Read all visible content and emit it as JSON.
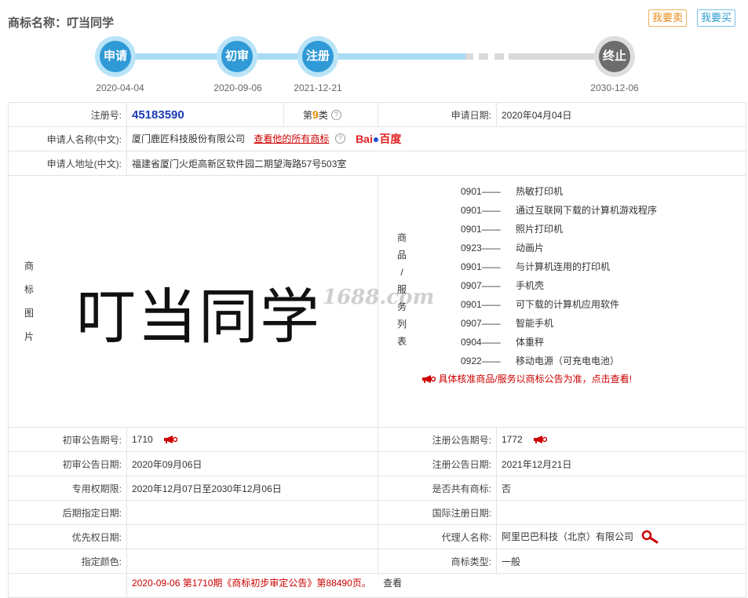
{
  "header": {
    "label": "商标名称：",
    "name": "叮当同学",
    "sell_label": "我要卖",
    "buy_label": "我要买"
  },
  "timeline": [
    {
      "label": "申请",
      "date": "2020-04-04"
    },
    {
      "label": "初审",
      "date": "2020-09-06"
    },
    {
      "label": "注册",
      "date": "2021-12-21"
    },
    {
      "label": "终止",
      "date": "2030-12-06"
    }
  ],
  "info": {
    "reg_no_label": "注册号:",
    "reg_no": "45183590",
    "class_prefix": "第",
    "class_num": "9",
    "class_suffix": "类",
    "apply_date_label": "申请日期:",
    "apply_date": "2020年04月04日",
    "applicant_label": "申请人名称(中文):",
    "applicant": "厦门鹿匠科技股份有限公司",
    "all_marks_link": "查看他的所有商标",
    "baidu_b1": "Bai",
    "baidu_b2": "百度",
    "address_label": "申请人地址(中文):",
    "address": "福建省厦门火炬高新区软件园二期望海路57号503室",
    "image_label": [
      "商",
      "标",
      "图",
      "片"
    ],
    "tm_text": "叮当同学",
    "watermark": "1688.com",
    "goods_label": [
      "商",
      "品",
      "/",
      "服",
      "务",
      "列",
      "表"
    ],
    "goods": [
      {
        "code": "0901——",
        "name": "热敏打印机"
      },
      {
        "code": "0901——",
        "name": "通过互联网下载的计算机游戏程序"
      },
      {
        "code": "0901——",
        "name": "照片打印机"
      },
      {
        "code": "0923——",
        "name": "动画片"
      },
      {
        "code": "0901——",
        "name": "与计算机连用的打印机"
      },
      {
        "code": "0907——",
        "name": "手机壳"
      },
      {
        "code": "0901——",
        "name": "可下载的计算机应用软件"
      },
      {
        "code": "0907——",
        "name": "智能手机"
      },
      {
        "code": "0904——",
        "name": "体重秤"
      },
      {
        "code": "0922——",
        "name": "移动电源（可充电电池）"
      }
    ],
    "goods_notice": "具体核准商品/服务以商标公告为准，点击查看!",
    "prelim_no_label": "初审公告期号:",
    "prelim_no": "1710",
    "reg_pub_no_label": "注册公告期号:",
    "reg_pub_no": "1772",
    "prelim_date_label": "初审公告日期:",
    "prelim_date": "2020年09月06日",
    "reg_pub_date_label": "注册公告日期:",
    "reg_pub_date": "2021年12月21日",
    "exclusive_label": "专用权期限:",
    "exclusive": "2020年12月07日至2030年12月06日",
    "shared_label": "是否共有商标:",
    "shared": "否",
    "later_label": "后期指定日期:",
    "later": "",
    "intl_label": "国际注册日期:",
    "intl": "",
    "priority_label": "优先权日期:",
    "priority": "",
    "agent_label": "代理人名称:",
    "agent": "阿里巴巴科技（北京）有限公司",
    "color_label": "指定颜色:",
    "color": "",
    "type_label": "商标类型:",
    "type": "一般",
    "pub_text": "2020-09-06 第1710期《商标初步审定公告》第88490页。",
    "pub_see": "查看"
  }
}
